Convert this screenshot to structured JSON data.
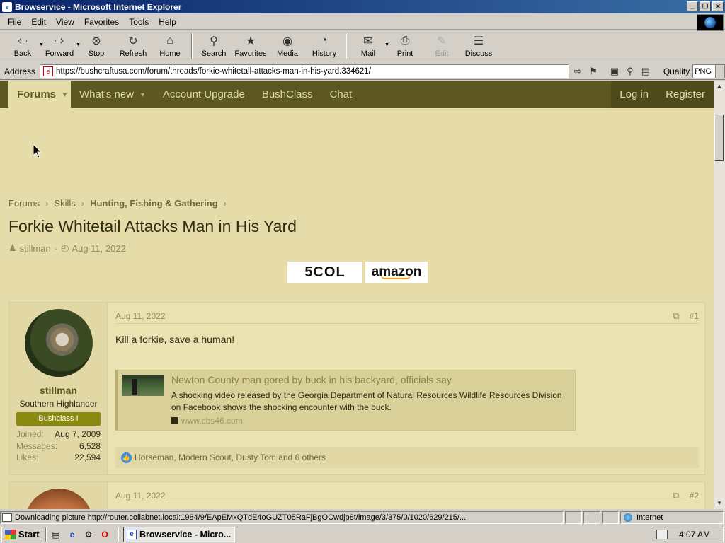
{
  "window": {
    "title": "Browservice - Microsoft Internet Explorer",
    "controls": [
      "_",
      "❐",
      "✕"
    ]
  },
  "menu": [
    "File",
    "Edit",
    "View",
    "Favorites",
    "Tools",
    "Help"
  ],
  "toolbar": [
    {
      "label": "Back",
      "icon": "back-arrow-icon",
      "glyph": "⇦",
      "dropdown": true,
      "enabled": true
    },
    {
      "label": "Forward",
      "icon": "forward-arrow-icon",
      "glyph": "⇨",
      "dropdown": true,
      "enabled": true
    },
    {
      "label": "Stop",
      "icon": "stop-icon",
      "glyph": "⊗",
      "enabled": true
    },
    {
      "label": "Refresh",
      "icon": "refresh-icon",
      "glyph": "↻",
      "enabled": true
    },
    {
      "label": "Home",
      "icon": "home-icon",
      "glyph": "⌂",
      "enabled": true
    },
    {
      "label": "Search",
      "icon": "search-icon",
      "glyph": "⚲",
      "enabled": true
    },
    {
      "label": "Favorites",
      "icon": "favorites-icon",
      "glyph": "★",
      "enabled": true
    },
    {
      "label": "Media",
      "icon": "media-icon",
      "glyph": "◉",
      "enabled": true
    },
    {
      "label": "History",
      "icon": "history-icon",
      "glyph": "◔",
      "enabled": true
    },
    {
      "label": "Mail",
      "icon": "mail-icon",
      "glyph": "✉",
      "dropdown": true,
      "enabled": true
    },
    {
      "label": "Print",
      "icon": "print-icon",
      "glyph": "⎙",
      "enabled": true
    },
    {
      "label": "Edit",
      "icon": "edit-icon",
      "glyph": "✎",
      "enabled": false
    },
    {
      "label": "Discuss",
      "icon": "discuss-icon",
      "glyph": "☰",
      "enabled": true
    }
  ],
  "address": {
    "label": "Address",
    "url": "https://bushcraftusa.com/forum/threads/forkie-whitetail-attacks-man-in-his-yard.334621/",
    "quality_label": "Quality",
    "quality_value": "PNG"
  },
  "site_nav": {
    "tabs": [
      {
        "label": "Forums",
        "active": true,
        "caret": true
      },
      {
        "label": "What's new",
        "caret": true
      },
      {
        "label": "Account Upgrade"
      },
      {
        "label": "BushClass"
      },
      {
        "label": "Chat"
      }
    ],
    "right": [
      "Log in",
      "Register"
    ]
  },
  "breadcrumb": [
    "Forums",
    "Skills",
    "Hunting, Fishing & Gathering"
  ],
  "thread": {
    "title": "Forkie Whitetail Attacks Man in His Yard",
    "author": "stillman",
    "date": "Aug 11, 2022"
  },
  "badges": {
    "scol": "5COL",
    "amazon": "amazon"
  },
  "posts": [
    {
      "username": "stillman",
      "user_title": "Southern Highlander",
      "banner": "Bushclass I",
      "stats": [
        {
          "label": "Joined:",
          "value": "Aug 7, 2009"
        },
        {
          "label": "Messages:",
          "value": "6,528"
        },
        {
          "label": "Likes:",
          "value": "22,594"
        }
      ],
      "date": "Aug 11, 2022",
      "number": "#1",
      "body": "Kill a forkie, save a human!",
      "unfurl": {
        "title": "Newton County man gored by buck in his backyard, officials say",
        "description": "A shocking video released by the Georgia Department of Natural Resources Wildlife Resources Division on Facebook shows the shocking encounter with the buck.",
        "source": "www.cbs46.com"
      },
      "reactions": "Horseman, Modern Scout, Dusty Tom and 6 others"
    },
    {
      "date": "Aug 11, 2022",
      "number": "#2"
    }
  ],
  "status": {
    "message": "Downloading picture http://router.collabnet.local:1984/9/EApEMxQTdE4oGUZT05RaFjBgOCwdjp8t/image/3/375/0/1020/629/215/...",
    "zone": "Internet"
  },
  "taskbar": {
    "start": "Start",
    "task": "Browservice - Micro...",
    "time": "4:07 AM"
  }
}
